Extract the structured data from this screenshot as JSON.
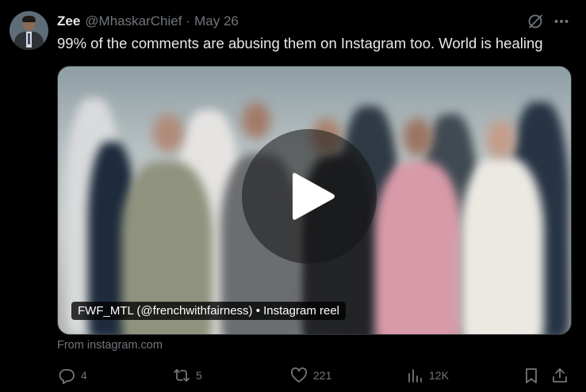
{
  "tweet": {
    "display_name": "Zee",
    "handle": "@MhaskarChief",
    "separator": "·",
    "date": "May 26",
    "text": "99% of the comments are abusing them on Instagram too. World is healing"
  },
  "media": {
    "label": "FWF_MTL (@frenchwithfairness) • Instagram reel",
    "source": "From instagram.com"
  },
  "actions": {
    "replies": "4",
    "reposts": "5",
    "likes": "221",
    "views": "12K"
  },
  "colors": {
    "background": "#000000",
    "text_primary": "#e7e9ea",
    "text_secondary": "#71767b",
    "border": "#2f3336"
  },
  "icons": [
    "grok-icon",
    "more-icon",
    "play-icon",
    "reply-icon",
    "repost-icon",
    "like-icon",
    "views-icon",
    "bookmark-icon",
    "share-icon"
  ]
}
